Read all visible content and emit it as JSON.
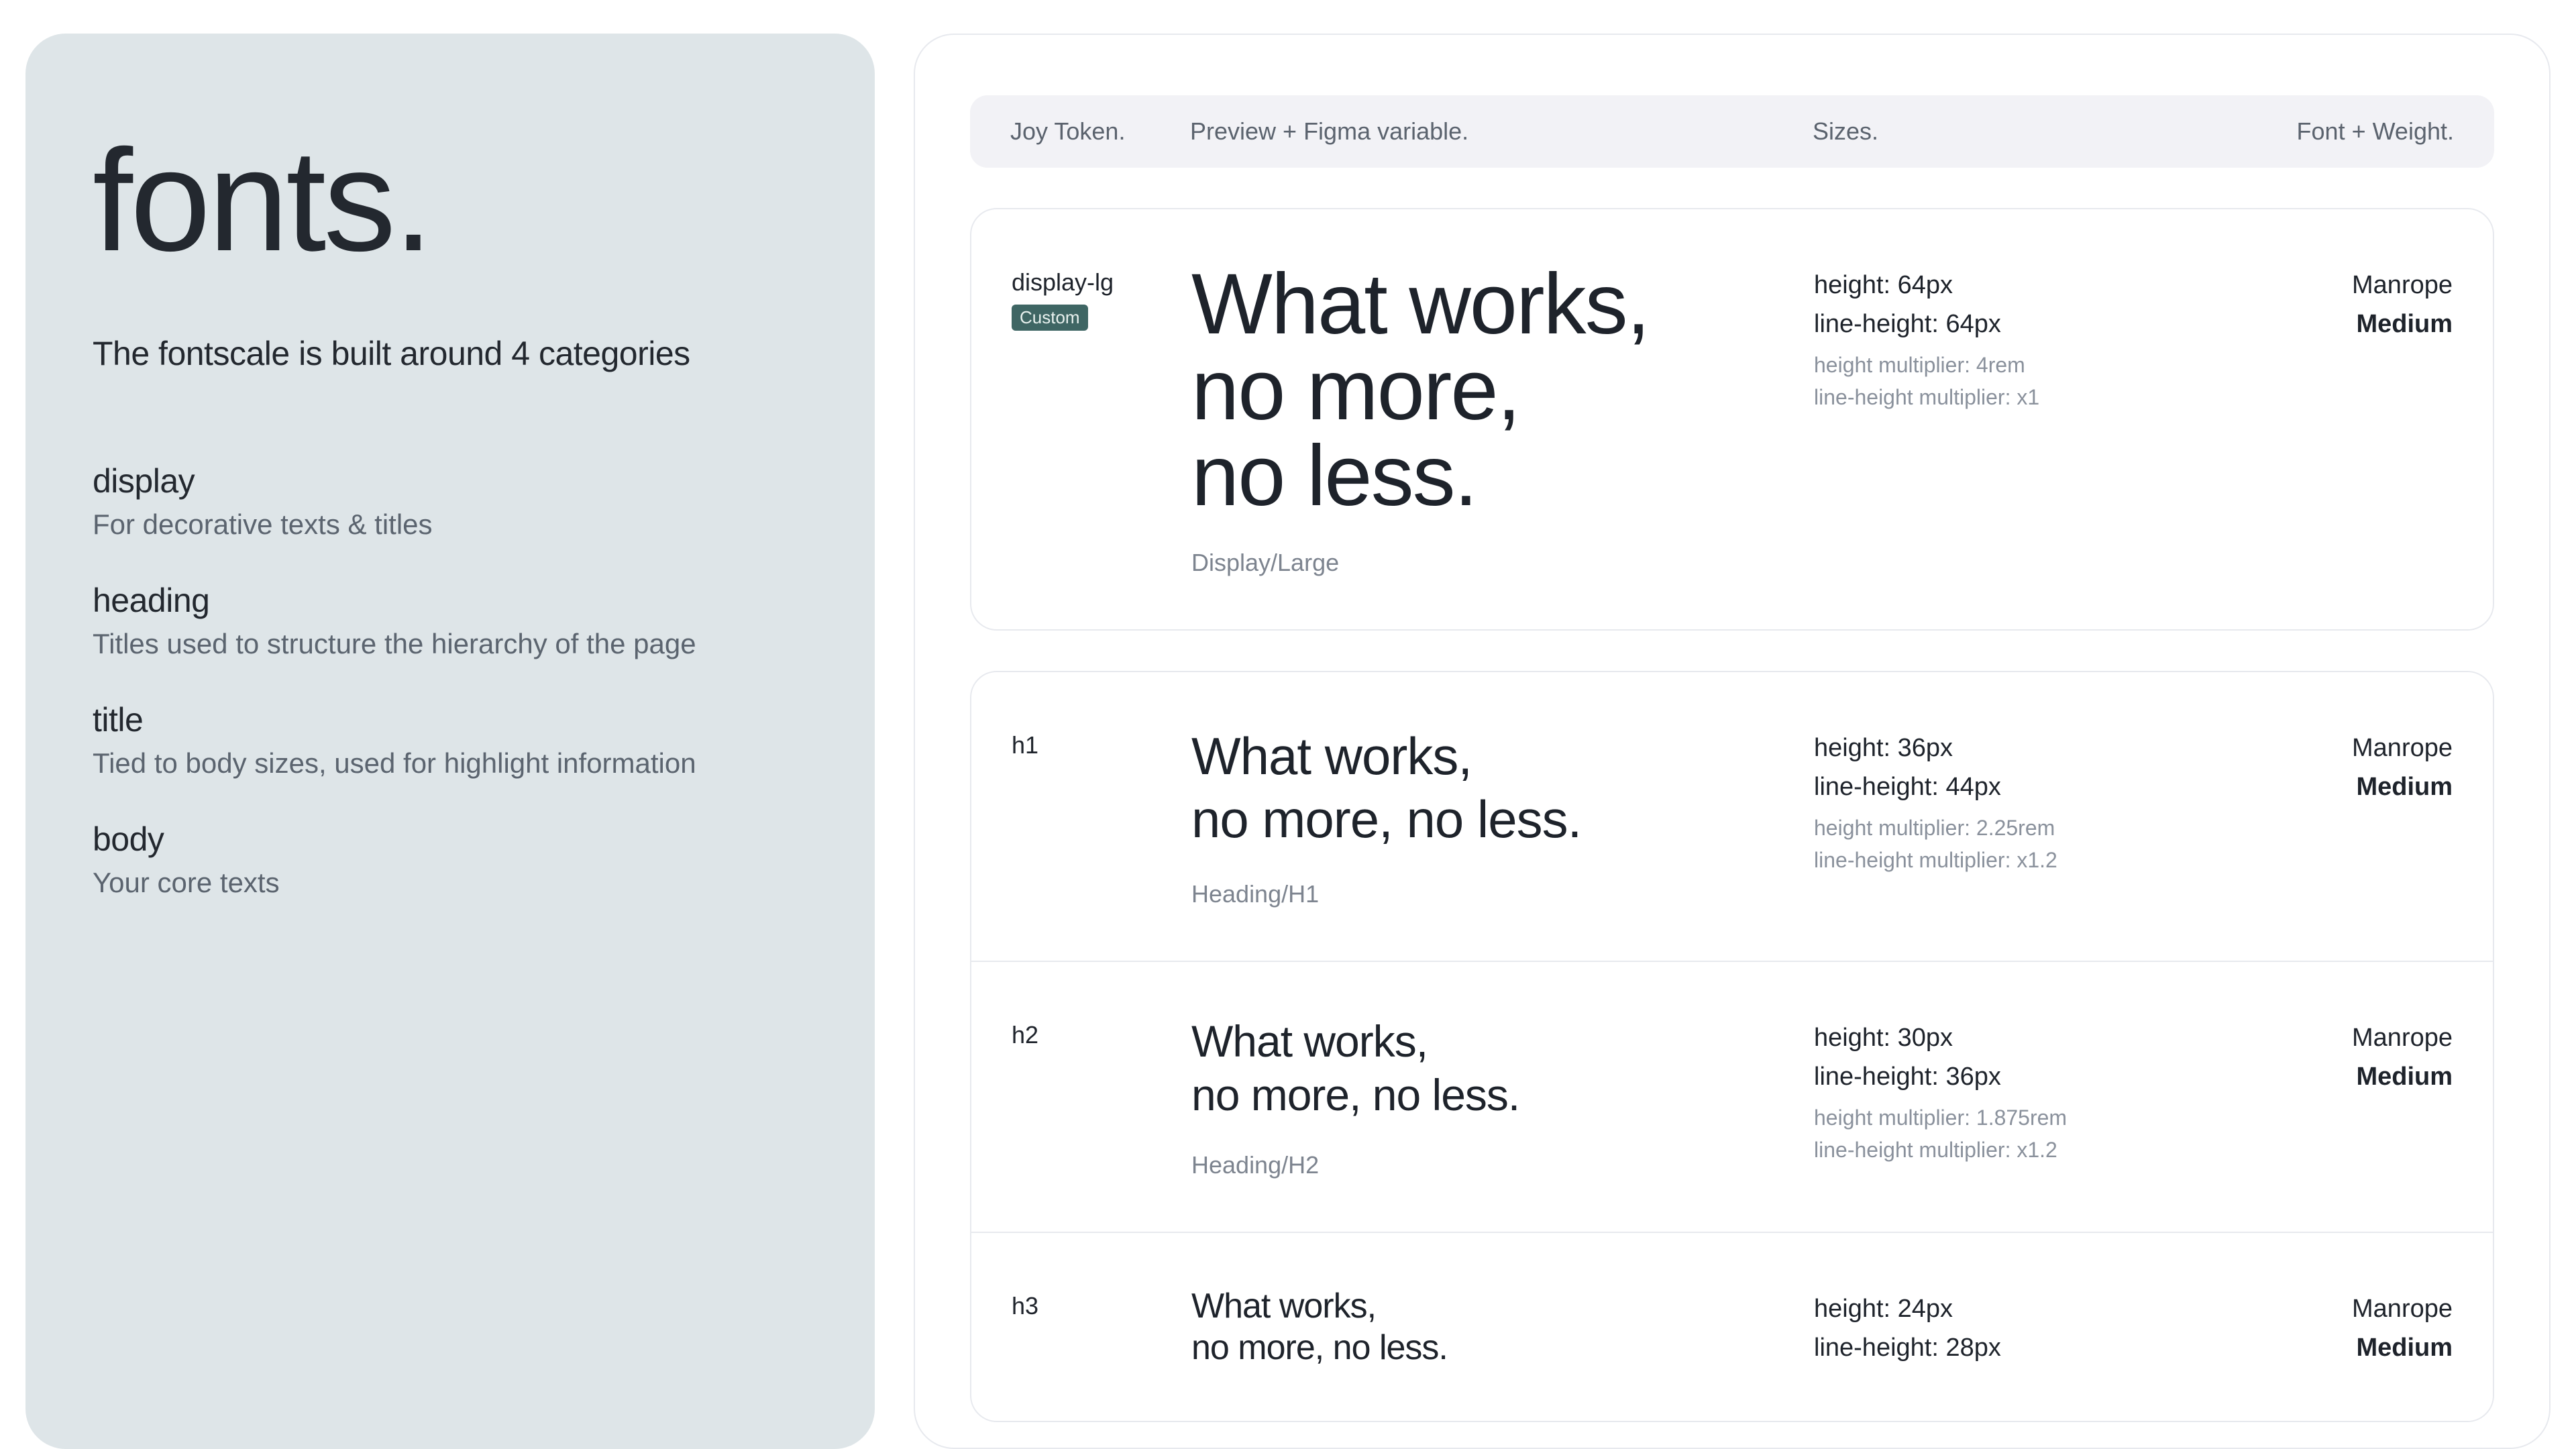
{
  "left": {
    "title": "fonts.",
    "subtitle": "The fontscale is built around 4 categories",
    "categories": [
      {
        "name": "display",
        "desc": "For decorative texts & titles"
      },
      {
        "name": "heading",
        "desc": "Titles used to structure the hierarchy of the page"
      },
      {
        "name": "title",
        "desc": "Tied to body sizes, used for highlight information"
      },
      {
        "name": "body",
        "desc": "Your core texts"
      }
    ]
  },
  "header": {
    "token": "Joy Token.",
    "preview": "Preview + Figma variable.",
    "sizes": "Sizes.",
    "font": "Font + Weight."
  },
  "rows": {
    "display_lg": {
      "token": "display-lg",
      "badge": "Custom",
      "line1": "What works,",
      "line2": "no more,",
      "line3": "no less.",
      "figma": "Display/Large",
      "height": "height: 64px",
      "lineheight": "line-height: 64px",
      "hm": "height multiplier: 4rem",
      "lhm": "line-height multiplier: x1",
      "font": "Manrope",
      "weight": "Medium"
    },
    "h1": {
      "token": "h1",
      "line1": "What works,",
      "line2": "no more, no less.",
      "figma": "Heading/H1",
      "height": "height: 36px",
      "lineheight": "line-height: 44px",
      "hm": "height multiplier: 2.25rem",
      "lhm": "line-height multiplier: x1.2",
      "font": "Manrope",
      "weight": "Medium"
    },
    "h2": {
      "token": "h2",
      "line1": "What works,",
      "line2": "no more, no less.",
      "figma": "Heading/H2",
      "height": "height: 30px",
      "lineheight": "line-height: 36px",
      "hm": "height multiplier: 1.875rem",
      "lhm": "line-height multiplier: x1.2",
      "font": "Manrope",
      "weight": "Medium"
    },
    "h3": {
      "token": "h3",
      "line1": "What works,",
      "line2": "no more, no less.",
      "height": "height: 24px",
      "lineheight": "line-height: 28px",
      "font": "Manrope",
      "weight": "Medium"
    }
  }
}
